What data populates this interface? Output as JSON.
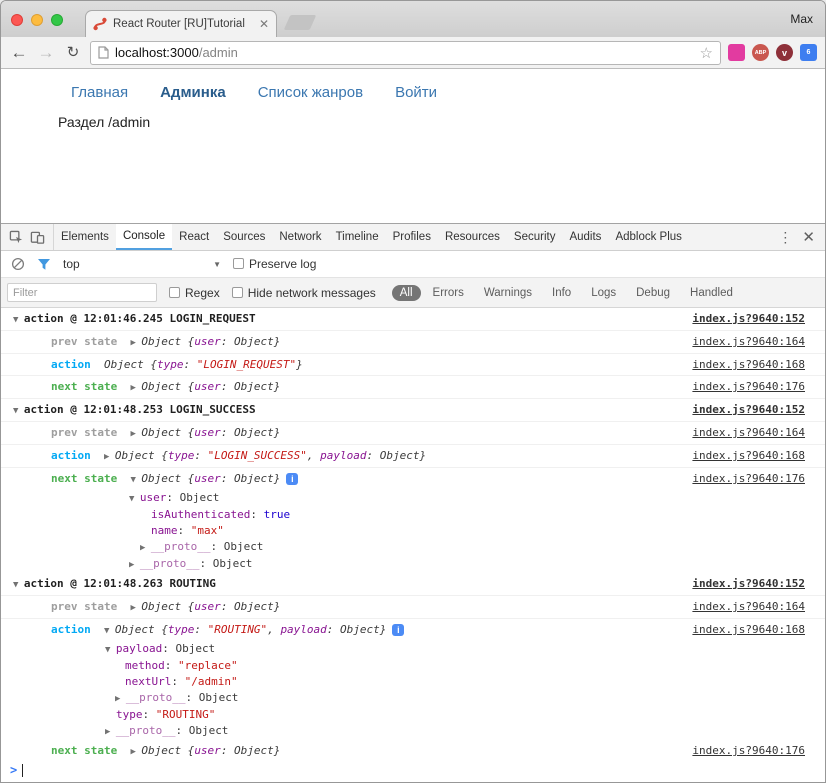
{
  "window": {
    "user_label": "Max",
    "tab_title": "React Router [RU]Tutorial",
    "url_host": "localhost:3000",
    "url_path": "/admin",
    "ext_abp": "ABP",
    "ext_pocket": "v",
    "ext_blue": "6"
  },
  "page": {
    "nav_links": [
      {
        "label": "Главная",
        "active": false
      },
      {
        "label": "Админка",
        "active": true
      },
      {
        "label": "Список жанров",
        "active": false
      },
      {
        "label": "Войти",
        "active": false
      }
    ],
    "body_text": "Раздел /admin"
  },
  "devtools": {
    "tabs": [
      "Elements",
      "Console",
      "React",
      "Sources",
      "Network",
      "Timeline",
      "Profiles",
      "Resources",
      "Security",
      "Audits",
      "Adblock Plus"
    ],
    "active_tab": "Console",
    "context": "top",
    "preserve_log": "Preserve log",
    "filter_placeholder": "Filter",
    "regex_label": "Regex",
    "hide_network_label": "Hide network messages",
    "levels": [
      "All",
      "Errors",
      "Warnings",
      "Info",
      "Logs",
      "Debug",
      "Handled"
    ],
    "active_level": "All"
  },
  "prompt": ">",
  "console_rows": [
    {
      "kind": "header",
      "pad": 12,
      "link": "index.js?9640:152",
      "segments": [
        {
          "t": "▼ ",
          "c": "arr"
        },
        {
          "t": "action @ 12:01:46.245 LOGIN_REQUEST",
          "c": "hdr"
        }
      ]
    },
    {
      "kind": "entry",
      "pad": 50,
      "link": "index.js?9640:164",
      "segments": [
        {
          "t": "prev state",
          "c": "lprev"
        },
        {
          "t": "  ",
          "c": "plain"
        },
        {
          "t": "▶ ",
          "c": "arr"
        },
        {
          "t": "Object {",
          "c": "pv"
        },
        {
          "t": "user",
          "c": "pvkey"
        },
        {
          "t": ": Object}",
          "c": "pv"
        }
      ]
    },
    {
      "kind": "entry",
      "pad": 50,
      "link": "index.js?9640:168",
      "segments": [
        {
          "t": "action",
          "c": "lact"
        },
        {
          "t": "  ",
          "c": "plain"
        },
        {
          "t": "Object {",
          "c": "pv"
        },
        {
          "t": "type",
          "c": "pvkey"
        },
        {
          "t": ": ",
          "c": "pv"
        },
        {
          "t": "\"LOGIN_REQUEST\"",
          "c": "pvstr"
        },
        {
          "t": "}",
          "c": "pv"
        }
      ]
    },
    {
      "kind": "entry",
      "pad": 50,
      "link": "index.js?9640:176",
      "segments": [
        {
          "t": "next state",
          "c": "lnext"
        },
        {
          "t": "  ",
          "c": "plain"
        },
        {
          "t": "▶ ",
          "c": "arr"
        },
        {
          "t": "Object {",
          "c": "pv"
        },
        {
          "t": "user",
          "c": "pvkey"
        },
        {
          "t": ": Object}",
          "c": "pv"
        }
      ]
    },
    {
      "kind": "header",
      "pad": 12,
      "link": "index.js?9640:152",
      "segments": [
        {
          "t": "▼ ",
          "c": "arr"
        },
        {
          "t": "action @ 12:01:48.253 LOGIN_SUCCESS",
          "c": "hdr"
        }
      ]
    },
    {
      "kind": "entry",
      "pad": 50,
      "link": "index.js?9640:164",
      "segments": [
        {
          "t": "prev state",
          "c": "lprev"
        },
        {
          "t": "  ",
          "c": "plain"
        },
        {
          "t": "▶ ",
          "c": "arr"
        },
        {
          "t": "Object {",
          "c": "pv"
        },
        {
          "t": "user",
          "c": "pvkey"
        },
        {
          "t": ": Object}",
          "c": "pv"
        }
      ]
    },
    {
      "kind": "entry",
      "pad": 50,
      "link": "index.js?9640:168",
      "segments": [
        {
          "t": "action",
          "c": "lact"
        },
        {
          "t": "  ",
          "c": "plain"
        },
        {
          "t": "▶ ",
          "c": "arr"
        },
        {
          "t": "Object {",
          "c": "pv"
        },
        {
          "t": "type",
          "c": "pvkey"
        },
        {
          "t": ": ",
          "c": "pv"
        },
        {
          "t": "\"LOGIN_SUCCESS\"",
          "c": "pvstr"
        },
        {
          "t": ", ",
          "c": "pv"
        },
        {
          "t": "payload",
          "c": "pvkey"
        },
        {
          "t": ": Object}",
          "c": "pv"
        }
      ]
    },
    {
      "kind": "entry",
      "pad": 50,
      "border": false,
      "link": "index.js?9640:176",
      "segments": [
        {
          "t": "next state",
          "c": "lnext"
        },
        {
          "t": "  ",
          "c": "plain"
        },
        {
          "t": "▼ ",
          "c": "arr"
        },
        {
          "t": "Object {",
          "c": "pv"
        },
        {
          "t": "user",
          "c": "pvkey"
        },
        {
          "t": ": Object}",
          "c": "pv"
        },
        {
          "t": "i",
          "c": "info"
        }
      ]
    },
    {
      "kind": "tree",
      "pad": 128,
      "segments": [
        {
          "t": "▼ ",
          "c": "arr"
        },
        {
          "t": "user",
          "c": "key"
        },
        {
          "t": ": Object",
          "c": "plain"
        }
      ]
    },
    {
      "kind": "tree",
      "pad": 150,
      "segments": [
        {
          "t": "isAuthenticated",
          "c": "key"
        },
        {
          "t": ": ",
          "c": "plain"
        },
        {
          "t": "true",
          "c": "bool"
        }
      ]
    },
    {
      "kind": "tree",
      "pad": 150,
      "segments": [
        {
          "t": "name",
          "c": "key"
        },
        {
          "t": ": ",
          "c": "plain"
        },
        {
          "t": "\"max\"",
          "c": "str"
        }
      ]
    },
    {
      "kind": "tree",
      "pad": 139,
      "segments": [
        {
          "t": "▶ ",
          "c": "arr"
        },
        {
          "t": "__proto__",
          "c": "proto"
        },
        {
          "t": ": Object",
          "c": "plain"
        }
      ]
    },
    {
      "kind": "tree",
      "pad": 128,
      "border": true,
      "segments": [
        {
          "t": "▶ ",
          "c": "arr"
        },
        {
          "t": "__proto__",
          "c": "proto"
        },
        {
          "t": ": Object",
          "c": "plain"
        }
      ]
    },
    {
      "kind": "header",
      "pad": 12,
      "link": "index.js?9640:152",
      "segments": [
        {
          "t": "▼ ",
          "c": "arr"
        },
        {
          "t": "action @ 12:01:48.263 ROUTING",
          "c": "hdr"
        }
      ]
    },
    {
      "kind": "entry",
      "pad": 50,
      "link": "index.js?9640:164",
      "segments": [
        {
          "t": "prev state",
          "c": "lprev"
        },
        {
          "t": "  ",
          "c": "plain"
        },
        {
          "t": "▶ ",
          "c": "arr"
        },
        {
          "t": "Object {",
          "c": "pv"
        },
        {
          "t": "user",
          "c": "pvkey"
        },
        {
          "t": ": Object}",
          "c": "pv"
        }
      ]
    },
    {
      "kind": "entry",
      "pad": 50,
      "border": false,
      "link": "index.js?9640:168",
      "segments": [
        {
          "t": "action",
          "c": "lact"
        },
        {
          "t": "  ",
          "c": "plain"
        },
        {
          "t": "▼ ",
          "c": "arr"
        },
        {
          "t": "Object {",
          "c": "pv"
        },
        {
          "t": "type",
          "c": "pvkey"
        },
        {
          "t": ": ",
          "c": "pv"
        },
        {
          "t": "\"ROUTING\"",
          "c": "pvstr"
        },
        {
          "t": ", ",
          "c": "pv"
        },
        {
          "t": "payload",
          "c": "pvkey"
        },
        {
          "t": ": Object}",
          "c": "pv"
        },
        {
          "t": "i",
          "c": "info"
        }
      ]
    },
    {
      "kind": "tree",
      "pad": 104,
      "segments": [
        {
          "t": "▼ ",
          "c": "arr"
        },
        {
          "t": "payload",
          "c": "key"
        },
        {
          "t": ": Object",
          "c": "plain"
        }
      ]
    },
    {
      "kind": "tree",
      "pad": 124,
      "segments": [
        {
          "t": "method",
          "c": "key"
        },
        {
          "t": ": ",
          "c": "plain"
        },
        {
          "t": "\"replace\"",
          "c": "str"
        }
      ]
    },
    {
      "kind": "tree",
      "pad": 124,
      "segments": [
        {
          "t": "nextUrl",
          "c": "key"
        },
        {
          "t": ": ",
          "c": "plain"
        },
        {
          "t": "\"/admin\"",
          "c": "str"
        }
      ]
    },
    {
      "kind": "tree",
      "pad": 114,
      "segments": [
        {
          "t": "▶ ",
          "c": "arr"
        },
        {
          "t": "__proto__",
          "c": "proto"
        },
        {
          "t": ": Object",
          "c": "plain"
        }
      ]
    },
    {
      "kind": "tree",
      "pad": 115,
      "segments": [
        {
          "t": "type",
          "c": "key"
        },
        {
          "t": ": ",
          "c": "plain"
        },
        {
          "t": "\"ROUTING\"",
          "c": "str"
        }
      ]
    },
    {
      "kind": "tree",
      "pad": 104,
      "border": true,
      "segments": [
        {
          "t": "▶ ",
          "c": "arr"
        },
        {
          "t": "__proto__",
          "c": "proto"
        },
        {
          "t": ": Object",
          "c": "plain"
        }
      ]
    },
    {
      "kind": "entry",
      "pad": 50,
      "link": "index.js?9640:176",
      "segments": [
        {
          "t": "next state",
          "c": "lnext"
        },
        {
          "t": "  ",
          "c": "plain"
        },
        {
          "t": "▶ ",
          "c": "arr"
        },
        {
          "t": "Object {",
          "c": "pv"
        },
        {
          "t": "user",
          "c": "pvkey"
        },
        {
          "t": ": Object}",
          "c": "pv"
        }
      ]
    }
  ]
}
